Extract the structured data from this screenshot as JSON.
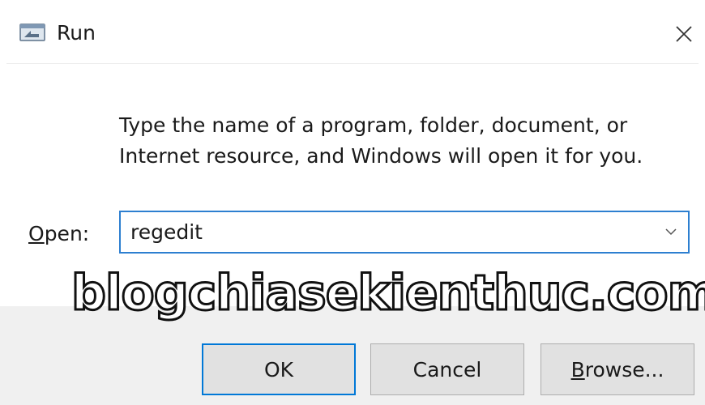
{
  "window": {
    "title": "Run",
    "icon": "run-app-icon",
    "close_icon": "close-icon"
  },
  "main": {
    "description_line1": "Type the name of a program, folder, document, or",
    "description_line2": "Internet resource, and Windows will open it for you.",
    "open_label_mnemonic": "O",
    "open_label_rest": "pen:",
    "open_value": "regedit",
    "dropdown_icon": "chevron-down-icon"
  },
  "watermark": {
    "text": "blogchiasekienthuc.com"
  },
  "buttons": {
    "ok": "OK",
    "cancel": "Cancel",
    "browse_mnemonic": "B",
    "browse_rest": "rowse..."
  },
  "colors": {
    "accent": "#0078d7",
    "focus_border": "#2d7fd0",
    "footer_bg": "#f0f0f0",
    "button_bg": "#e1e1e1"
  }
}
